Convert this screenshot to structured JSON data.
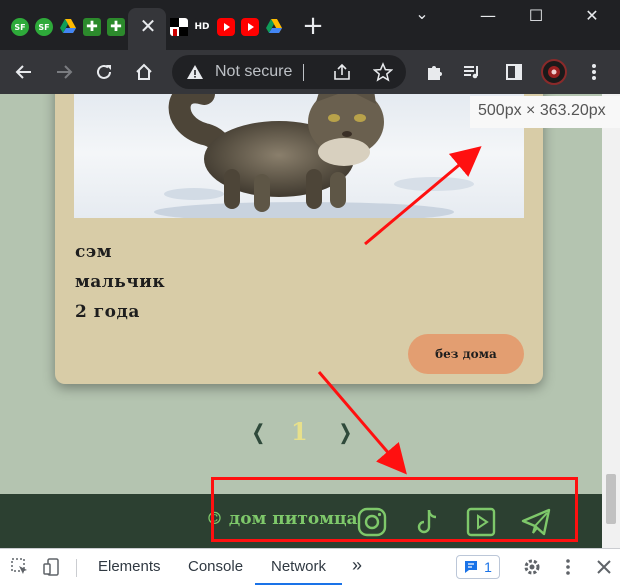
{
  "browser": {
    "tabs": {
      "favicons": [
        "sf-icon",
        "sf-icon",
        "drive-icon",
        "cross-icon",
        "cross-icon",
        "puzzle-icon",
        "hd-icon",
        "youtube-icon",
        "youtube-icon",
        "drive-icon"
      ],
      "sf_label": "SF",
      "hd_label": "HD",
      "close_label": "✕",
      "new_tab_label": "+"
    },
    "window": {
      "minimize": "—",
      "maximize": "☐",
      "close": "✕",
      "dropdown": "⌄"
    },
    "omnibox": {
      "security_text": "Not secure"
    }
  },
  "page": {
    "card": {
      "pet_name": "сэм",
      "pet_sex": "мальчик",
      "pet_age": "2 года",
      "status_button": "без дома"
    },
    "pagination": {
      "prev": "❬",
      "current": "1",
      "next": "❭"
    },
    "footer": {
      "brand": "© дом питомца",
      "social_icons": [
        "instagram-icon",
        "tiktok-icon",
        "youtube-icon",
        "telegram-icon"
      ]
    }
  },
  "inspector_tooltip": "500px × 363.20px",
  "devtools": {
    "tabs": [
      "Elements",
      "Console",
      "Network"
    ],
    "active_tab": "Network",
    "more_label": "»",
    "issues_count": "1"
  },
  "colors": {
    "page_bg": "#b4c4b0",
    "card_bg": "#d8cca7",
    "button_bg": "#e39e71",
    "footer_bg": "#2c4031",
    "brand_green": "#7ec86a",
    "pagination_current": "#e7e08b",
    "annotation_red": "#ff1010"
  }
}
